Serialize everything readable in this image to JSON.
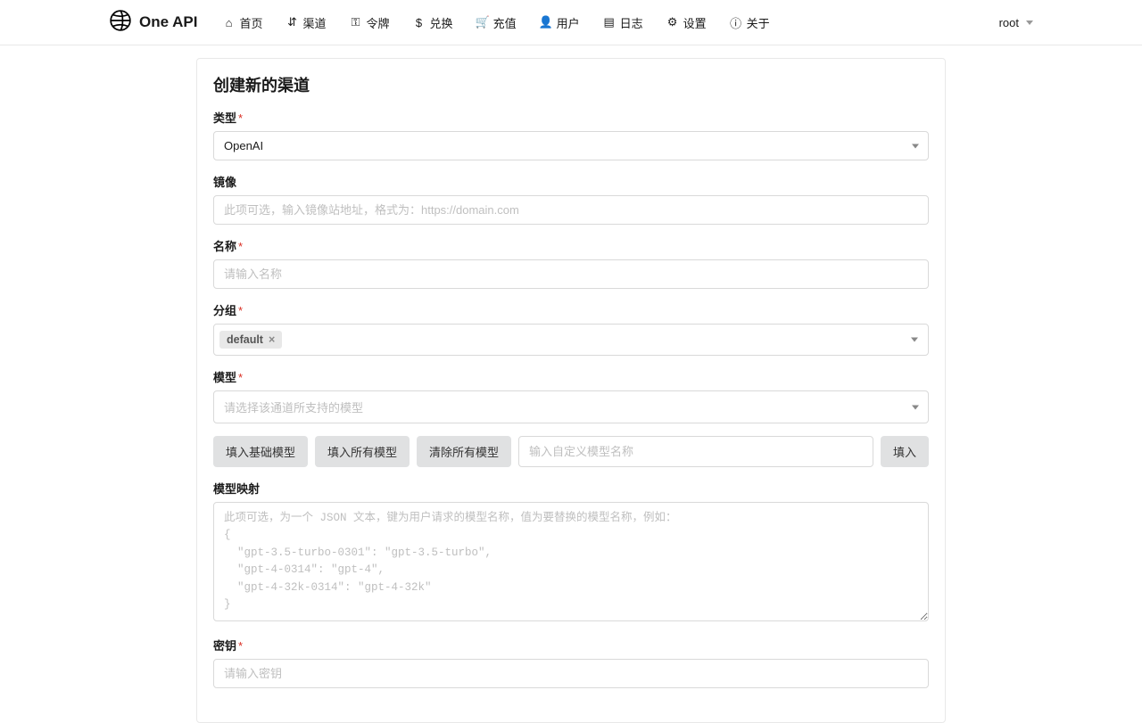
{
  "app": {
    "name": "One API"
  },
  "nav": [
    {
      "label": "首页"
    },
    {
      "label": "渠道"
    },
    {
      "label": "令牌"
    },
    {
      "label": "兑换"
    },
    {
      "label": "充值"
    },
    {
      "label": "用户"
    },
    {
      "label": "日志"
    },
    {
      "label": "设置"
    },
    {
      "label": "关于"
    }
  ],
  "user": {
    "name": "root"
  },
  "page": {
    "title": "创建新的渠道"
  },
  "form": {
    "type": {
      "label": "类型",
      "value": "OpenAI"
    },
    "mirror": {
      "label": "镜像",
      "placeholder": "此项可选，输入镜像站地址，格式为：https://domain.com"
    },
    "name": {
      "label": "名称",
      "placeholder": "请输入名称"
    },
    "group": {
      "label": "分组",
      "tag": "default"
    },
    "model": {
      "label": "模型",
      "placeholder": "请选择该通道所支持的模型"
    },
    "buttons": {
      "fill_base": "填入基础模型",
      "fill_all": "填入所有模型",
      "clear_all": "清除所有模型",
      "custom_placeholder": "输入自定义模型名称",
      "fill": "填入"
    },
    "mapping": {
      "label": "模型映射",
      "placeholder": "此项可选，为一个 JSON 文本，键为用户请求的模型名称，值为要替换的模型名称，例如：\n{\n  \"gpt-3.5-turbo-0301\": \"gpt-3.5-turbo\",\n  \"gpt-4-0314\": \"gpt-4\",\n  \"gpt-4-32k-0314\": \"gpt-4-32k\"\n}"
    },
    "key": {
      "label": "密钥",
      "placeholder": "请输入密钥"
    }
  }
}
